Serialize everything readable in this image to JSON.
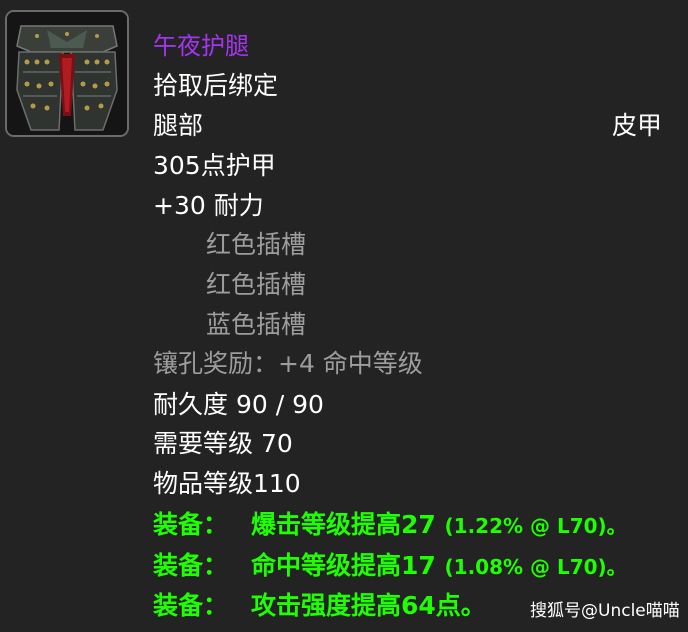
{
  "tooltip": {
    "icon": "leather-leggings-icon",
    "name": "午夜护腿",
    "name_color": "#a335ee",
    "bind": "拾取后绑定",
    "slot": "腿部",
    "armor_type": "皮甲",
    "armor": "305点护甲",
    "stamina": "+30 耐力",
    "sockets": [
      "红色插槽",
      "红色插槽",
      "蓝色插槽"
    ],
    "socket_bonus": "镶孔奖励：+4 命中等级",
    "durability": "耐久度 90 / 90",
    "required_level": "需要等级 70",
    "item_level": "物品等级110",
    "equip_label": "装备：",
    "equip_effects": [
      {
        "text": "爆击等级提高27",
        "detail": "(1.22% @ L70)。"
      },
      {
        "text": "命中等级提高17",
        "detail": "(1.08% @ L70)。"
      },
      {
        "text": "攻击强度提高64点。",
        "detail": ""
      }
    ],
    "equip_color": "#1eff00"
  },
  "watermark": "搜狐号@Uncle喵喵"
}
